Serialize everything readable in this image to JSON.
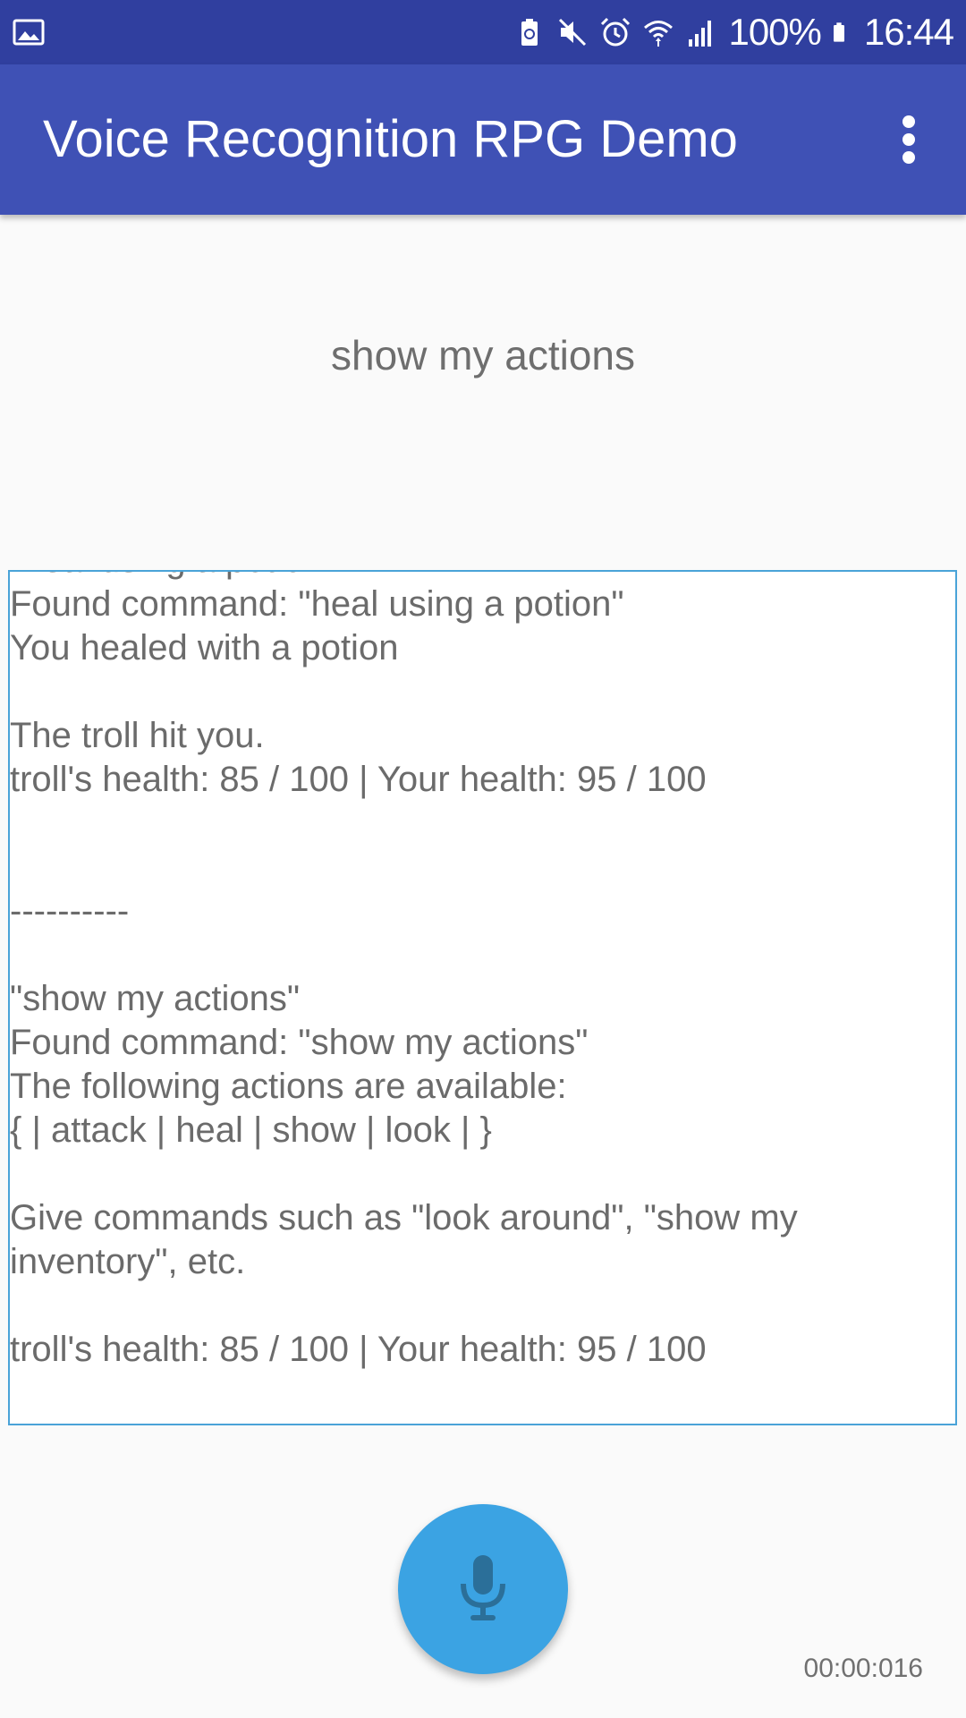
{
  "status_bar": {
    "battery_percent": "100%",
    "time": "16:44",
    "icons": [
      "image-icon",
      "battery-saver-icon",
      "mute-icon",
      "alarm-icon",
      "wifi-icon",
      "signal-icon",
      "battery-icon"
    ]
  },
  "app_bar": {
    "title": "Voice Recognition RPG Demo",
    "overflow_icon": "more-vert-icon"
  },
  "recognized_text": "show my actions",
  "log": {
    "lines": [
      "\"heal using a potion\"",
      "Found command: \"heal using a potion\"",
      "You healed with a potion",
      "",
      "The troll hit you.",
      "troll's health: 85 / 100 | Your health: 95 / 100",
      "",
      "",
      "----------",
      "",
      "\"show my actions\"",
      "Found command: \"show my actions\"",
      "The following actions are available:",
      "{ | attack | heal | show | look | }",
      "",
      "Give commands such as \"look around\", \"show my inventory\", etc.",
      "",
      "troll's health: 85 / 100 | Your health: 95 / 100"
    ]
  },
  "mic_button": {
    "icon": "microphone-icon"
  },
  "timer": "00:00:016",
  "colors": {
    "status_bar": "#303f9f",
    "app_bar": "#3f51b5",
    "fab": "#3ba3e3",
    "log_border": "#4aa3d8"
  }
}
